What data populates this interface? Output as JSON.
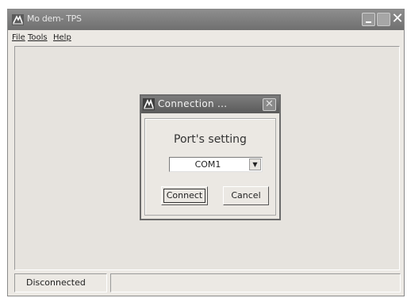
{
  "window": {
    "title": "Mo dem- TPS",
    "icon": "modem-app-icon"
  },
  "menu": {
    "items": [
      "File",
      "Tools",
      "Help"
    ]
  },
  "status": {
    "connection": "Disconnected",
    "extra": ""
  },
  "dialog": {
    "title": "Connection ...",
    "heading": "Port's setting",
    "port_value": "COM1",
    "connect_label": "Connect",
    "cancel_label": "Cancel"
  },
  "colors": {
    "titlebar": "#7a7a7a",
    "window_bg": "#ece9e4"
  }
}
